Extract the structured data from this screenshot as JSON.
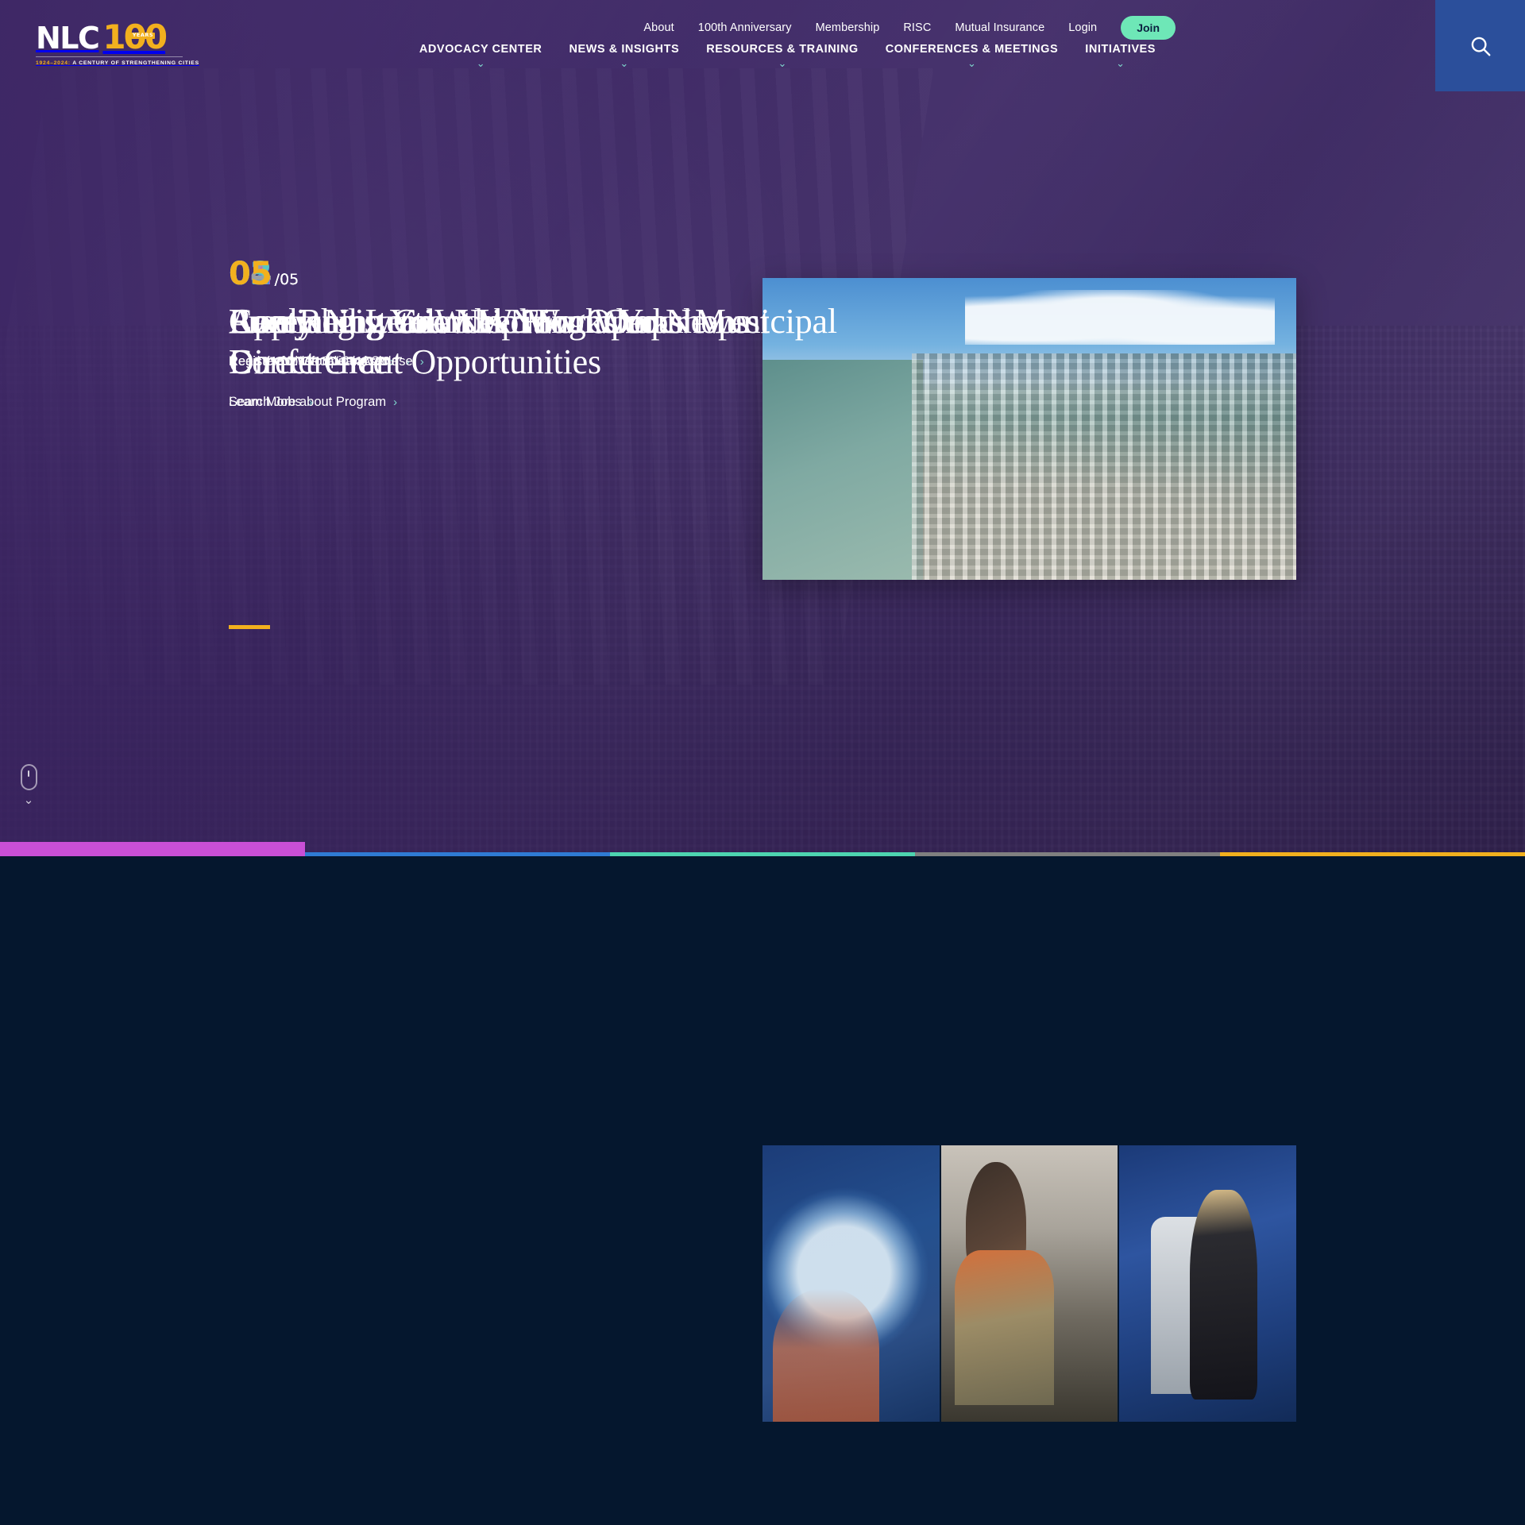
{
  "brand": {
    "name": "NLC",
    "anniversary": "100",
    "years_badge": "YEARS",
    "tagline_years": "1924–2024:",
    "tagline_text": "A CENTURY OF STRENGTHENING CITIES",
    "logo_gold": "#F2B01E"
  },
  "utility_nav": {
    "items": [
      {
        "label": "About"
      },
      {
        "label": "100th Anniversary"
      },
      {
        "label": "Membership"
      },
      {
        "label": "RISC"
      },
      {
        "label": "Mutual Insurance"
      },
      {
        "label": "Login"
      }
    ],
    "join_label": "Join",
    "join_color": "#6EE7B7"
  },
  "main_nav": {
    "items": [
      {
        "label": "ADVOCACY CENTER",
        "has_dropdown": true
      },
      {
        "label": "NEWS & INSIGHTS",
        "has_dropdown": true
      },
      {
        "label": "RESOURCES & TRAINING",
        "has_dropdown": true
      },
      {
        "label": "CONFERENCES & MEETINGS",
        "has_dropdown": true
      },
      {
        "label": "INITIATIVES",
        "has_dropdown": true
      }
    ],
    "chevron_color": "#7FD8CE"
  },
  "search": {
    "icon": "search-icon",
    "block_color": "#2B4F9B"
  },
  "hero": {
    "slides": [
      {
        "index": "05",
        "total": "/05",
        "counter_color": "#F2B01E",
        "title": "Free Registration Is Now Open",
        "cta": "Register Now for Virtual Course",
        "image": "aerial-coastal-city"
      },
      {
        "index": "03",
        "total": "/05",
        "counter_color": "#5BC8C0",
        "title": "Race and Leadership Workshops",
        "cta": "Read the Cities Speak Article",
        "image": "aerial-coastal-city"
      },
      {
        "index": "01",
        "total": "/05",
        "counter_color": "#C94FD6",
        "title": "Apply Now to Work From Our Newest Direct Grant Opportunities",
        "cta": "Learn More about Program",
        "image": "aerial-coastal-city"
      },
      {
        "index": "02",
        "total": "/05",
        "counter_color": "#4B8FE0",
        "title": "Everything You Need From Your Municipal Conference",
        "cta": "Search Jobs",
        "image": "aerial-coastal-city"
      },
      {
        "index": "04",
        "total": "/05",
        "counter_color": "#9AA0A6",
        "title": "Continuing Grant Writing Workshops",
        "cta": "Register for Virtual Course",
        "image": "aerial-coastal-city"
      }
    ],
    "arrow_glyph": "›",
    "accent_bar_color": "#F2B01E"
  },
  "scroll_cue": {
    "icon": "mouse-scroll-icon",
    "chevron": "⌄"
  },
  "progress": {
    "segments": [
      {
        "color": "#C94FD6",
        "active": true
      },
      {
        "color": "#2F7BD4",
        "active": false
      },
      {
        "color": "#4DD4B0",
        "active": false
      },
      {
        "color": "#808080",
        "active": false
      },
      {
        "color": "#F2B01E",
        "active": false
      }
    ]
  },
  "lower_section": {
    "background": "#05172E",
    "cards": [
      {
        "name": "globe-in-hands-image"
      },
      {
        "name": "shop-counter-image"
      },
      {
        "name": "stage-speaker-image"
      }
    ]
  }
}
